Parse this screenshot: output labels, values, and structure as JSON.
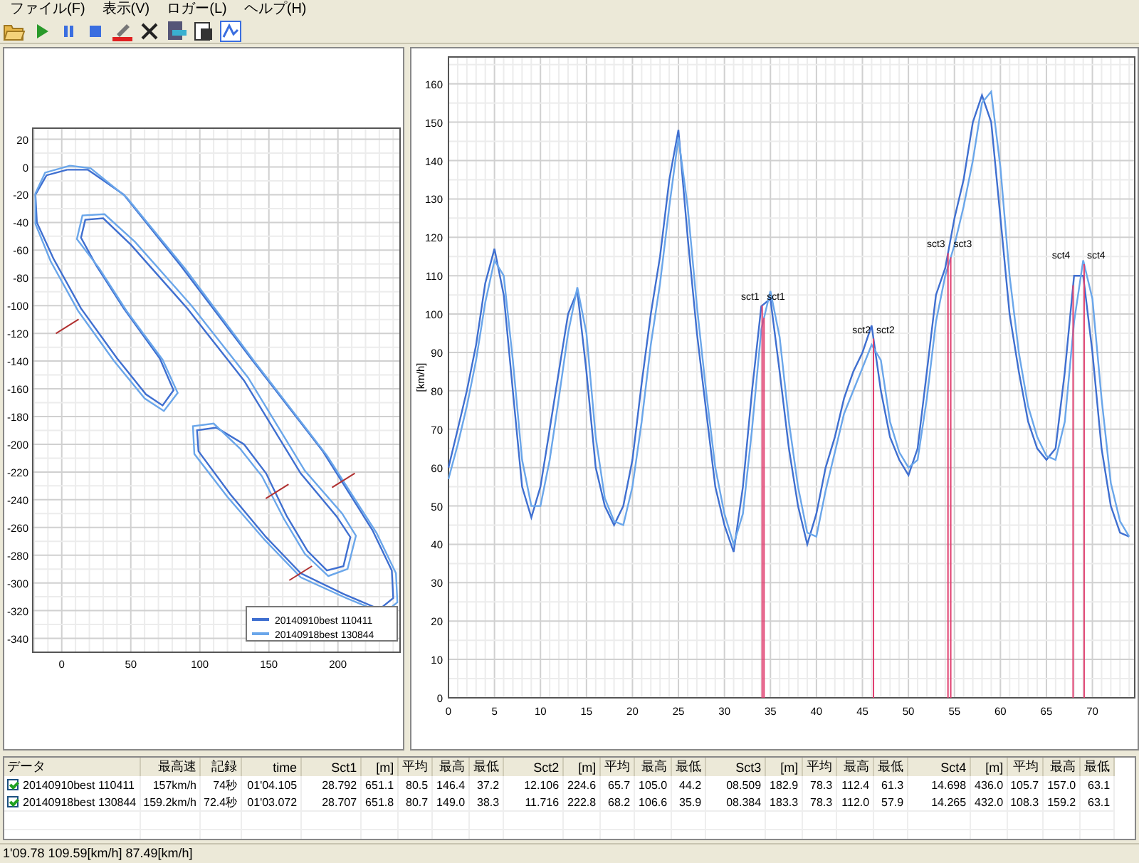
{
  "menu": [
    "ファイル(F)",
    "表示(V)",
    "ロガー(L)",
    "ヘルプ(H)"
  ],
  "toolbar": [
    {
      "kind": "folder"
    },
    {
      "kind": "play"
    },
    {
      "kind": "pause"
    },
    {
      "kind": "stop"
    },
    {
      "kind": "marker"
    },
    {
      "kind": "delete"
    },
    {
      "kind": "export"
    },
    {
      "kind": "copy"
    },
    {
      "kind": "chart"
    }
  ],
  "track_map": {
    "x_ticks": [
      "0",
      "50",
      "100",
      "150",
      "200"
    ],
    "y_ticks": [
      "20",
      "0",
      "-20",
      "-40",
      "-60",
      "-80",
      "-100",
      "-120",
      "-140",
      "-160",
      "-180",
      "-200",
      "-220",
      "-240",
      "-260",
      "-280",
      "-300",
      "-320",
      "-340"
    ],
    "legend": [
      {
        "label": "20140910best 110411",
        "color": "#3f6fd0"
      },
      {
        "label": "20140918best 130844",
        "color": "#6aa6ea"
      }
    ]
  },
  "speed_chart": {
    "chart_data": {
      "type": "line",
      "ylabel": "[km/h]",
      "grid": true,
      "xlim": [
        0,
        74.6
      ],
      "ylim": [
        0,
        167
      ],
      "xticks": [
        0,
        5,
        10,
        15,
        20,
        25,
        30,
        35,
        40,
        45,
        50,
        55,
        60,
        65,
        70
      ],
      "yticks": [
        0,
        10,
        20,
        30,
        40,
        50,
        60,
        70,
        80,
        90,
        100,
        110,
        120,
        130,
        140,
        150,
        160
      ],
      "x": [
        0,
        1,
        2,
        3,
        4,
        5,
        6,
        7,
        8,
        9,
        10,
        11,
        12,
        13,
        14,
        15,
        16,
        17,
        18,
        19,
        20,
        21,
        22,
        23,
        24,
        25,
        26,
        27,
        28,
        29,
        30,
        31,
        32,
        33,
        34,
        35,
        36,
        37,
        38,
        39,
        40,
        41,
        42,
        43,
        44,
        45,
        46,
        47,
        48,
        49,
        50,
        51,
        52,
        53,
        54,
        55,
        56,
        57,
        58,
        59,
        60,
        61,
        62,
        63,
        64,
        65,
        66,
        67,
        68,
        69,
        70,
        71,
        72,
        73,
        74
      ],
      "series": [
        {
          "color": "#3f6fd0",
          "values": [
            60,
            70,
            80,
            92,
            108,
            117,
            105,
            80,
            55,
            47,
            55,
            70,
            85,
            100,
            106,
            85,
            60,
            50,
            45,
            50,
            62,
            82,
            100,
            115,
            135,
            148,
            120,
            95,
            75,
            55,
            45,
            38,
            55,
            80,
            102,
            104,
            85,
            65,
            50,
            40,
            48,
            60,
            68,
            78,
            85,
            90,
            97,
            80,
            68,
            62,
            58,
            65,
            85,
            105,
            112,
            125,
            135,
            150,
            157,
            150,
            125,
            100,
            85,
            72,
            65,
            62,
            65,
            85,
            110,
            110,
            90,
            65,
            50,
            43,
            42
          ]
        },
        {
          "color": "#6aa6ea",
          "values": [
            57,
            66,
            76,
            88,
            103,
            114,
            110,
            88,
            62,
            50,
            50,
            62,
            78,
            95,
            107,
            95,
            68,
            52,
            46,
            45,
            55,
            72,
            92,
            108,
            128,
            146,
            128,
            102,
            80,
            60,
            48,
            40,
            48,
            70,
            96,
            106,
            94,
            72,
            55,
            43,
            42,
            54,
            64,
            74,
            80,
            86,
            92,
            88,
            72,
            64,
            60,
            62,
            78,
            98,
            110,
            118,
            128,
            140,
            155,
            158,
            138,
            110,
            90,
            76,
            68,
            63,
            62,
            72,
            98,
            114,
            104,
            78,
            56,
            46,
            42
          ]
        }
      ],
      "ref_lines": [
        {
          "axis": "x",
          "value": 34.1,
          "label": "sct1"
        },
        {
          "axis": "x",
          "value": 34.3,
          "label": "sct1"
        },
        {
          "axis": "x",
          "value": 46.2,
          "label": "sct2"
        },
        {
          "axis": "x",
          "value": 46.2,
          "label": "sct2"
        },
        {
          "axis": "x",
          "value": 54.3,
          "label": "sct3"
        },
        {
          "axis": "x",
          "value": 54.6,
          "label": "sct3"
        },
        {
          "axis": "x",
          "value": 67.9,
          "label": "sct4"
        },
        {
          "axis": "x",
          "value": 69.1,
          "label": "sct4"
        }
      ]
    }
  },
  "table": {
    "columns": [
      "データ",
      "最高速",
      "記録",
      "time",
      "Sct1",
      "[m]",
      "平均",
      "最高",
      "最低",
      "Sct2",
      "[m]",
      "平均",
      "最高",
      "最低",
      "Sct3",
      "[m]",
      "平均",
      "最高",
      "最低",
      "Sct4",
      "[m]",
      "平均",
      "最高",
      "最低"
    ],
    "rows": [
      {
        "checked": true,
        "cells": [
          "20140910best 110411",
          "157km/h",
          "74秒",
          "01'04.105",
          "28.792",
          "651.1",
          "80.5",
          "146.4",
          "37.2",
          "12.106",
          "224.6",
          "65.7",
          "105.0",
          "44.2",
          "08.509",
          "182.9",
          "78.3",
          "112.4",
          "61.3",
          "14.698",
          "436.0",
          "105.7",
          "157.0",
          "63.1"
        ]
      },
      {
        "checked": true,
        "cells": [
          "20140918best 130844",
          "159.2km/h",
          "72.4秒",
          "01'03.072",
          "28.707",
          "651.8",
          "80.7",
          "149.0",
          "38.3",
          "11.716",
          "222.8",
          "68.2",
          "106.6",
          "35.9",
          "08.384",
          "183.3",
          "78.3",
          "112.0",
          "57.9",
          "14.265",
          "432.0",
          "108.3",
          "159.2",
          "63.1"
        ]
      }
    ]
  },
  "status_bar": "1'09.78 109.59[km/h] 87.49[km/h]"
}
